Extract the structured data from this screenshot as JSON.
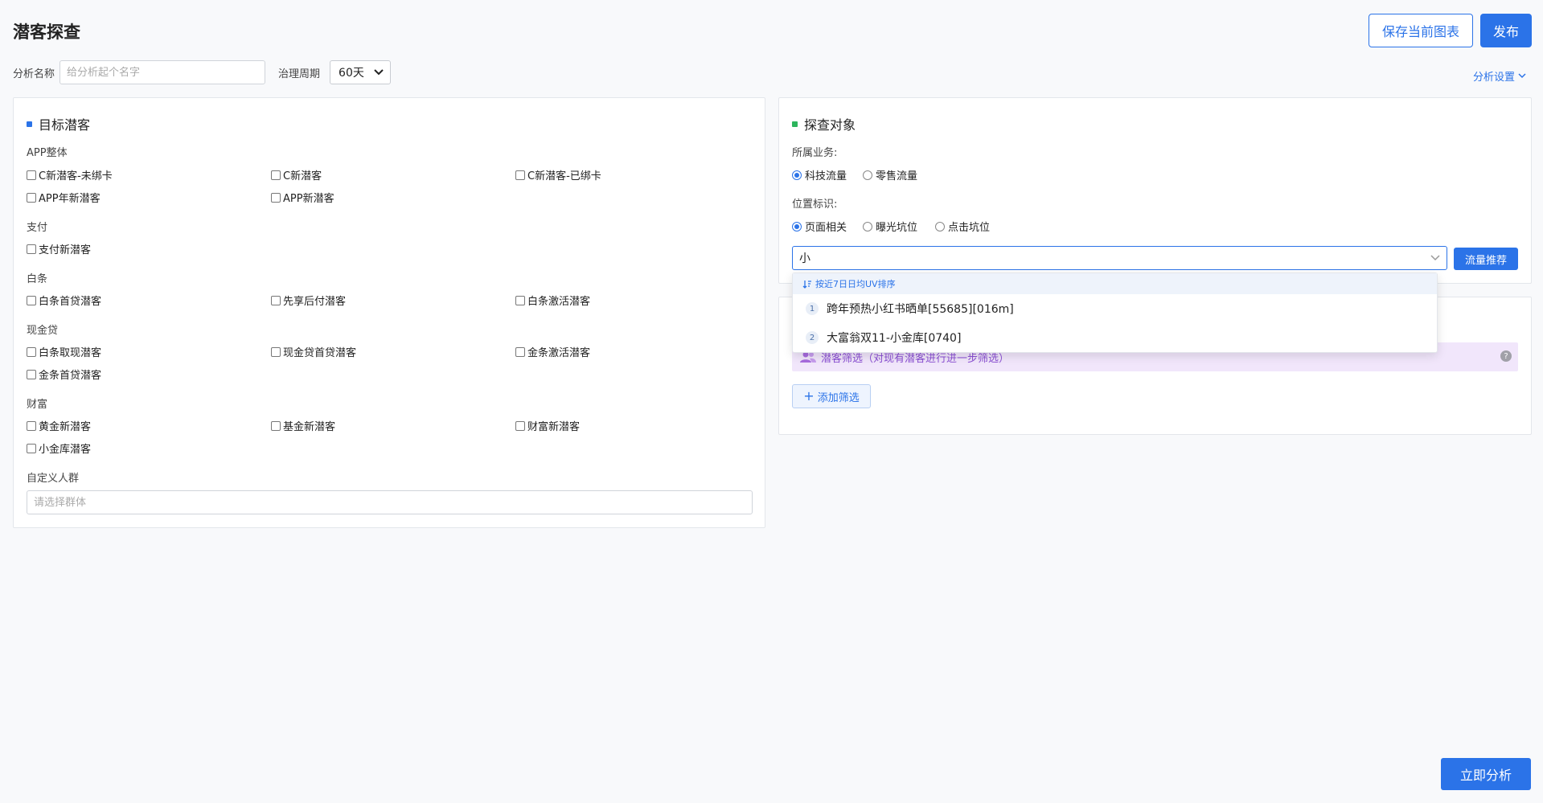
{
  "header": {
    "title": "潜客探查",
    "save_chart_label": "保存当前图表",
    "publish_label": "发布"
  },
  "form": {
    "name_label": "分析名称",
    "name_placeholder": "给分析起个名字",
    "name_value": "",
    "period_label": "治理周期",
    "period_value": "60天",
    "settings_label": "分析设置"
  },
  "target": {
    "title": "目标潜客",
    "accent": "#2b73e8",
    "groups": [
      {
        "label": "APP整体",
        "items": [
          "C新潜客-未绑卡",
          "C新潜客",
          "C新潜客-已绑卡",
          "APP年新潜客",
          "APP新潜客"
        ]
      },
      {
        "label": "支付",
        "items": [
          "支付新潜客"
        ]
      },
      {
        "label": "白条",
        "items": [
          "白条首贷潜客",
          "先享后付潜客",
          "白条激活潜客"
        ]
      },
      {
        "label": "现金贷",
        "items": [
          "白条取现潜客",
          "现金贷首贷潜客",
          "金条激活潜客",
          "金条首贷潜客"
        ]
      },
      {
        "label": "财富",
        "items": [
          "黄金新潜客",
          "基金新潜客",
          "财富新潜客",
          "小金库潜客"
        ]
      }
    ],
    "custom_label": "自定义人群",
    "custom_placeholder": "请选择群体"
  },
  "probe": {
    "title": "探查对象",
    "accent": "#2db55d",
    "business_label": "所属业务:",
    "business_options": [
      "科技流量",
      "零售流量"
    ],
    "business_selected": "科技流量",
    "position_label": "位置标识:",
    "position_options": [
      "页面相关",
      "曝光坑位",
      "点击坑位"
    ],
    "position_selected": "页面相关",
    "search_value": "小",
    "recommend_label": "流量推荐",
    "dropdown": {
      "sort_label": "按近7日日均UV排序",
      "items": [
        {
          "index": "1",
          "text": "跨年预热小红书晒单[55685][016m]"
        },
        {
          "index": "2",
          "text": "大富翁双11-小金库[0740]"
        }
      ]
    }
  },
  "filter": {
    "bar_text": "潜客筛选（对现有潜客进行进一步筛选）",
    "help_mark": "?",
    "add_label": "添加筛选"
  },
  "footer": {
    "analyze_label": "立即分析"
  }
}
